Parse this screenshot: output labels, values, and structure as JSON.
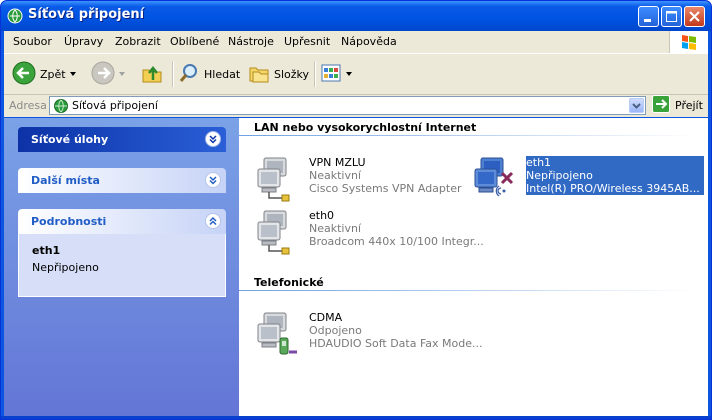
{
  "window": {
    "title": "Síťová připojení"
  },
  "menubar": {
    "items": [
      "Soubor",
      "Úpravy",
      "Zobrazit",
      "Oblíbené",
      "Nástroje",
      "Upřesnit",
      "Nápověda"
    ]
  },
  "toolbar": {
    "back_label": "Zpět",
    "search_label": "Hledat",
    "folders_label": "Složky"
  },
  "address": {
    "label": "Adresa",
    "value": "Síťová připojení",
    "go_label": "Přejít"
  },
  "tasks": {
    "network_tasks": "Síťové úlohy",
    "other_places": "Další místa",
    "details": "Podrobnosti",
    "details_name": "eth1",
    "details_status": "Nepřipojeno"
  },
  "groups": [
    {
      "title": "LAN nebo vysokorychlostní Internet",
      "items": [
        {
          "name": "VPN MZLU",
          "status": "Neaktivní",
          "device": "Cisco Systems VPN Adapter"
        },
        {
          "name": "eth1",
          "status": "Nepřipojeno",
          "device": "Intel(R) PRO/Wireless 3945AB..."
        },
        {
          "name": "eth0",
          "status": "Neaktivní",
          "device": "Broadcom 440x 10/100 Integr..."
        }
      ]
    },
    {
      "title": "Telefonické",
      "items": [
        {
          "name": "CDMA",
          "status": "Odpojeno",
          "device": "HDAUDIO Soft Data Fax Mode..."
        }
      ]
    }
  ],
  "colors": {
    "title_bar": "#0054e3",
    "task_pane": "#6f8ee0",
    "selection": "#316ac5"
  }
}
